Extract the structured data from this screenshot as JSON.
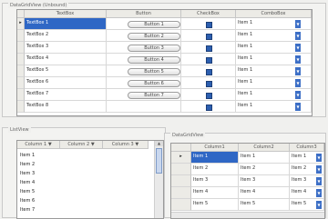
{
  "top_group": {
    "title": "DataGridView (Unbound)",
    "columns": [
      "TextBox",
      "Button",
      "CheckBox",
      "ComboBox"
    ],
    "rows": [
      {
        "text": "TextBox 1",
        "button": "Button 1",
        "combo": "Item 1"
      },
      {
        "text": "TextBox 2",
        "button": "Button 2",
        "combo": "Item 1"
      },
      {
        "text": "TextBox 3",
        "button": "Button 3",
        "combo": "Item 1"
      },
      {
        "text": "TextBox 4",
        "button": "Button 4",
        "combo": "Item 1"
      },
      {
        "text": "TextBox 5",
        "button": "Button 5",
        "combo": "Item 1"
      },
      {
        "text": "TextBox 6",
        "button": "Button 6",
        "combo": "Item 1"
      },
      {
        "text": "TextBox 7",
        "button": "Button 7",
        "combo": "Item 1"
      },
      {
        "text": "TextBox 8",
        "button": "",
        "combo": "Item 1"
      }
    ],
    "row_marker": "▸"
  },
  "list_group": {
    "title": "ListView",
    "columns": [
      "Column 1",
      "Column 2",
      "Column 3"
    ],
    "items": [
      "Item 1",
      "Item 2",
      "Item 3",
      "Item 4",
      "Item 5",
      "Item 6",
      "Item 7"
    ]
  },
  "bound_group": {
    "title": "DataGridView",
    "columns": [
      "Column1",
      "Column2",
      "Column3"
    ],
    "rows": [
      [
        "Item 1",
        "Item 1",
        "Item 1"
      ],
      [
        "Item 2",
        "Item 2",
        "Item 2"
      ],
      [
        "Item 3",
        "Item 3",
        "Item 3"
      ],
      [
        "Item 4",
        "Item 4",
        "Item 4"
      ],
      [
        "Item 5",
        "Item 5",
        "Item 5"
      ]
    ],
    "row_marker": "▸"
  },
  "icons": {
    "dropdown": "▼",
    "scroll_up": "▲",
    "scroll_down": "▼"
  },
  "colors": {
    "selection": "#2f67c5",
    "checkbox": "#2c5fb0",
    "header": "#ecebe6"
  }
}
